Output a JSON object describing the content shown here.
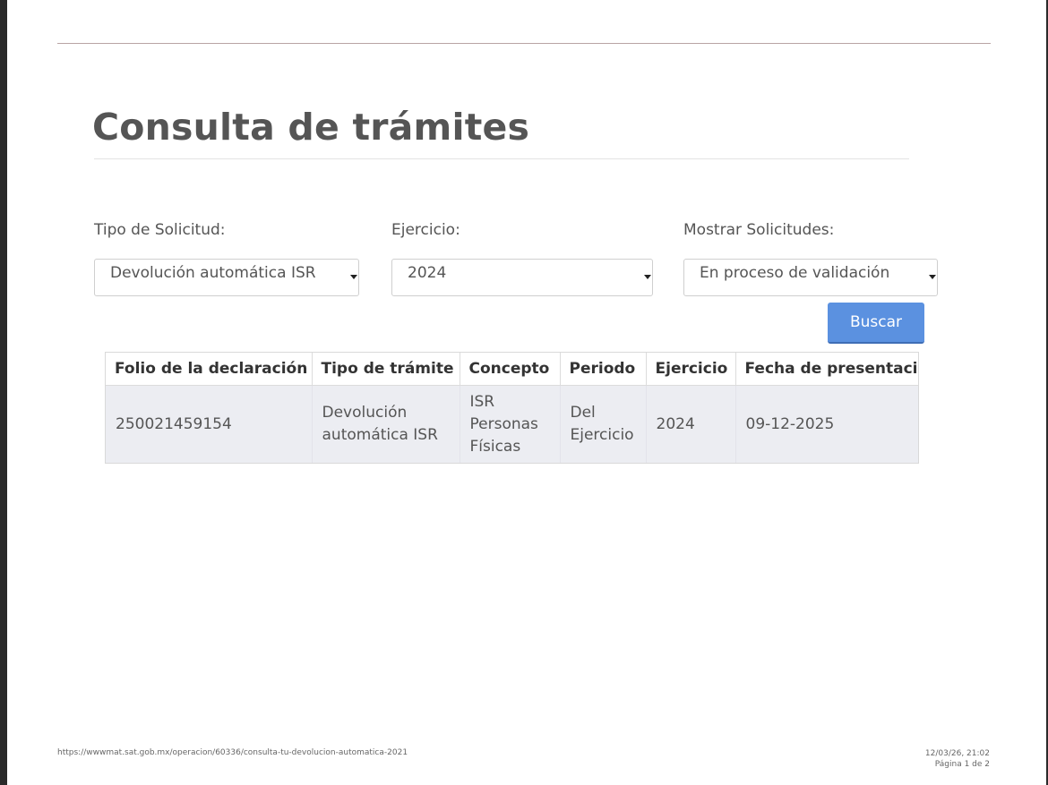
{
  "page": {
    "title": "Consulta de trámites"
  },
  "filters": {
    "tipo_label": "Tipo de Solicitud:",
    "tipo_value": "Devolución automática ISR",
    "ejercicio_label": "Ejercicio:",
    "ejercicio_value": "2024",
    "mostrar_label": "Mostrar Solicitudes:",
    "mostrar_value": "En proceso de validación",
    "search_label": "Buscar"
  },
  "table": {
    "headers": [
      "Folio de la declaración",
      "Tipo de trámite",
      "Concepto",
      "Periodo",
      "Ejercicio",
      "Fecha de presentació"
    ],
    "rows": [
      [
        "250021459154",
        "Devolución automática ISR",
        "ISR Personas Físicas",
        "Del Ejercicio",
        "2024",
        "09-12-2025"
      ]
    ]
  },
  "footer": {
    "url": "https://wwwmat.sat.gob.mx/operacion/60336/consulta-tu-devolucion-automatica-2021",
    "datetime": "12/03/26, 21:02",
    "page": "Página 1 de 2"
  },
  "colors": {
    "button": "#5b91e0",
    "row_background": "#ecedf2",
    "title": "#555555"
  }
}
